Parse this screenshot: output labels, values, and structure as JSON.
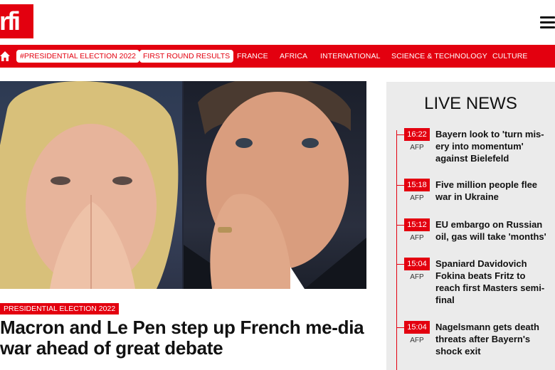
{
  "header": {
    "logo_text": "rfi",
    "menu_icon": "hamburger-menu-icon"
  },
  "nav": {
    "home_icon": "home-icon",
    "pills": [
      "#PRESIDENTIAL ELECTION 2022",
      "FIRST ROUND RESULTS"
    ],
    "links": [
      "FRANCE",
      "AFRICA",
      "INTERNATIONAL",
      "SCIENCE & TECHNOLOGY",
      "CULTURE"
    ]
  },
  "article": {
    "tag": "PRESIDENTIAL ELECTION 2022",
    "headline": "Macron and Le Pen step up French me-dia war ahead of great debate"
  },
  "live_news": {
    "title": "LIVE NEWS",
    "items": [
      {
        "time": "16:22",
        "source": "AFP",
        "title": "Bayern look to 'turn mis-ery into momentum' against Bielefeld"
      },
      {
        "time": "15:18",
        "source": "AFP",
        "title": "Five million people flee war in Ukraine"
      },
      {
        "time": "15:12",
        "source": "AFP",
        "title": "EU embargo on Russian oil, gas will take 'months'"
      },
      {
        "time": "15:04",
        "source": "AFP",
        "title": "Spaniard Davidovich Fokina beats Fritz to reach first Masters semi-final"
      },
      {
        "time": "15:04",
        "source": "AFP",
        "title": "Nagelsmann gets death threats after Bayern's shock exit"
      }
    ]
  },
  "colors": {
    "brand_red": "#e3000f",
    "panel_grey": "#ebebeb"
  }
}
